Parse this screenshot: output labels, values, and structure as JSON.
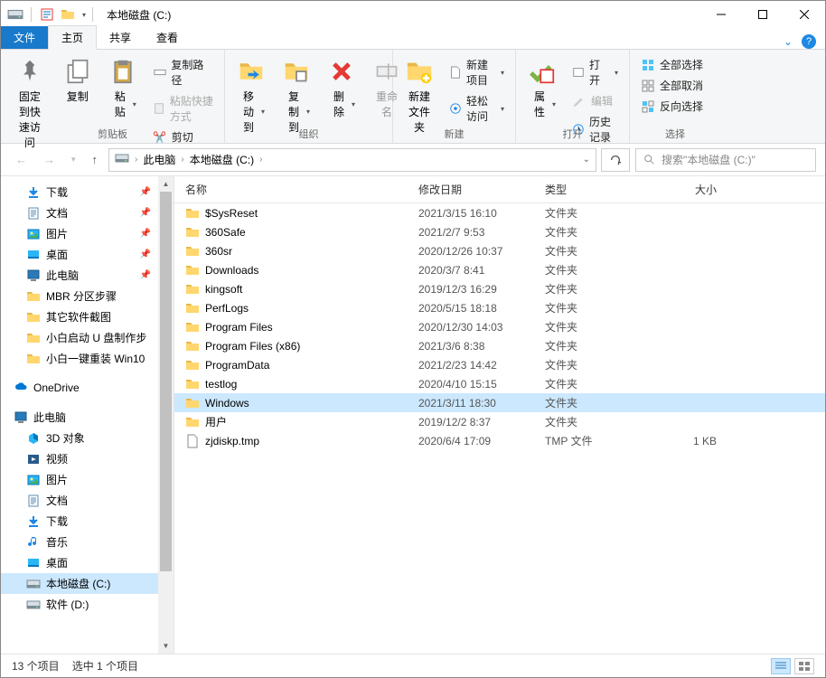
{
  "window": {
    "title": "本地磁盘 (C:)"
  },
  "tabs": {
    "file": "文件",
    "home": "主页",
    "share": "共享",
    "view": "查看"
  },
  "ribbon": {
    "clipboard": {
      "pin": "固定到快\n速访问",
      "copy": "复制",
      "paste": "粘贴",
      "copypath": "复制路径",
      "pasteshort": "粘贴快捷方式",
      "cut": "剪切",
      "label": "剪贴板"
    },
    "organize": {
      "moveto": "移动到",
      "copyto": "复制到",
      "delete": "删除",
      "rename": "重命名",
      "label": "组织"
    },
    "new": {
      "newfolder": "新建\n文件夹",
      "newitem": "新建项目",
      "easyaccess": "轻松访问",
      "label": "新建"
    },
    "open": {
      "props": "属性",
      "open": "打开",
      "edit": "编辑",
      "history": "历史记录",
      "label": "打开"
    },
    "select": {
      "selectall": "全部选择",
      "selectnone": "全部取消",
      "invert": "反向选择",
      "label": "选择"
    }
  },
  "breadcrumb": {
    "pc": "此电脑",
    "drive": "本地磁盘 (C:)"
  },
  "search": {
    "placeholder": "搜索\"本地磁盘 (C:)\""
  },
  "nav": {
    "downloads": "下载",
    "documents": "文档",
    "pictures": "图片",
    "desktop": "桌面",
    "thispc_short": "此电脑",
    "mbr": "MBR 分区步骤",
    "other_shot": "其它软件截图",
    "xiaobai_usb": "小白启动 U 盘制作步",
    "xiaobai_win10": "小白一键重装 Win10",
    "onedrive": "OneDrive",
    "thispc": "此电脑",
    "objects3d": "3D 对象",
    "videos": "视频",
    "pictures2": "图片",
    "documents2": "文档",
    "downloads2": "下载",
    "music": "音乐",
    "desktop2": "桌面",
    "cdrive": "本地磁盘 (C:)",
    "ddrive": "软件 (D:)"
  },
  "columns": {
    "name": "名称",
    "date": "修改日期",
    "type": "类型",
    "size": "大小"
  },
  "files": [
    {
      "name": "$SysReset",
      "date": "2021/3/15 16:10",
      "type": "文件夹",
      "size": "",
      "icon": "folder",
      "selected": false
    },
    {
      "name": "360Safe",
      "date": "2021/2/7 9:53",
      "type": "文件夹",
      "size": "",
      "icon": "folder",
      "selected": false
    },
    {
      "name": "360sr",
      "date": "2020/12/26 10:37",
      "type": "文件夹",
      "size": "",
      "icon": "folder",
      "selected": false
    },
    {
      "name": "Downloads",
      "date": "2020/3/7 8:41",
      "type": "文件夹",
      "size": "",
      "icon": "folder",
      "selected": false
    },
    {
      "name": "kingsoft",
      "date": "2019/12/3 16:29",
      "type": "文件夹",
      "size": "",
      "icon": "folder",
      "selected": false
    },
    {
      "name": "PerfLogs",
      "date": "2020/5/15 18:18",
      "type": "文件夹",
      "size": "",
      "icon": "folder",
      "selected": false
    },
    {
      "name": "Program Files",
      "date": "2020/12/30 14:03",
      "type": "文件夹",
      "size": "",
      "icon": "folder",
      "selected": false
    },
    {
      "name": "Program Files (x86)",
      "date": "2021/3/6 8:38",
      "type": "文件夹",
      "size": "",
      "icon": "folder",
      "selected": false
    },
    {
      "name": "ProgramData",
      "date": "2021/2/23 14:42",
      "type": "文件夹",
      "size": "",
      "icon": "folder",
      "selected": false
    },
    {
      "name": "testlog",
      "date": "2020/4/10 15:15",
      "type": "文件夹",
      "size": "",
      "icon": "folder",
      "selected": false
    },
    {
      "name": "Windows",
      "date": "2021/3/11 18:30",
      "type": "文件夹",
      "size": "",
      "icon": "folder",
      "selected": true
    },
    {
      "name": "用户",
      "date": "2019/12/2 8:37",
      "type": "文件夹",
      "size": "",
      "icon": "folder",
      "selected": false
    },
    {
      "name": "zjdiskp.tmp",
      "date": "2020/6/4 17:09",
      "type": "TMP 文件",
      "size": "1 KB",
      "icon": "file",
      "selected": false
    }
  ],
  "status": {
    "items": "13 个项目",
    "selected": "选中 1 个项目"
  }
}
